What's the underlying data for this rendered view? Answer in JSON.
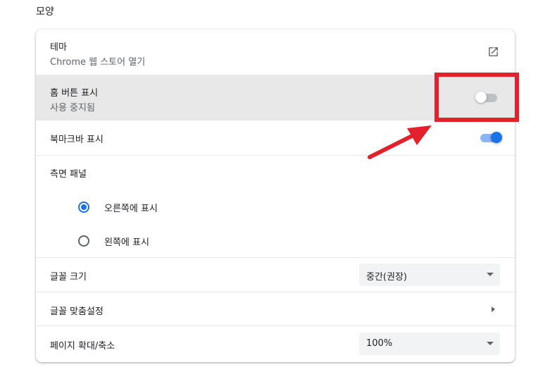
{
  "section": {
    "title": "모양"
  },
  "theme": {
    "label": "테마",
    "sub": "Chrome 웹 스토어 열기"
  },
  "home_button": {
    "label": "홈 버튼 표시",
    "sub": "사용 중지됨",
    "enabled": false
  },
  "bookmarks_bar": {
    "label": "북마크바 표시",
    "enabled": true
  },
  "side_panel": {
    "label": "측면 패널",
    "options": [
      {
        "label": "오른쪽에 표시",
        "selected": true
      },
      {
        "label": "왼쪽에 표시",
        "selected": false
      }
    ]
  },
  "font_size": {
    "label": "글꼴 크기",
    "value": "중간(권장)"
  },
  "customize_fonts": {
    "label": "글꼴 맞춤설정"
  },
  "page_zoom": {
    "label": "페이지 확대/축소",
    "value": "100%"
  },
  "colors": {
    "accent": "#1a73e8",
    "annotation": "#e3202b",
    "highlight_row": "#e8e8e8"
  },
  "icons": {
    "theme_link": "open-in-new-icon",
    "fonts_link": "chevron-right-icon",
    "select": "caret-down-icon"
  }
}
